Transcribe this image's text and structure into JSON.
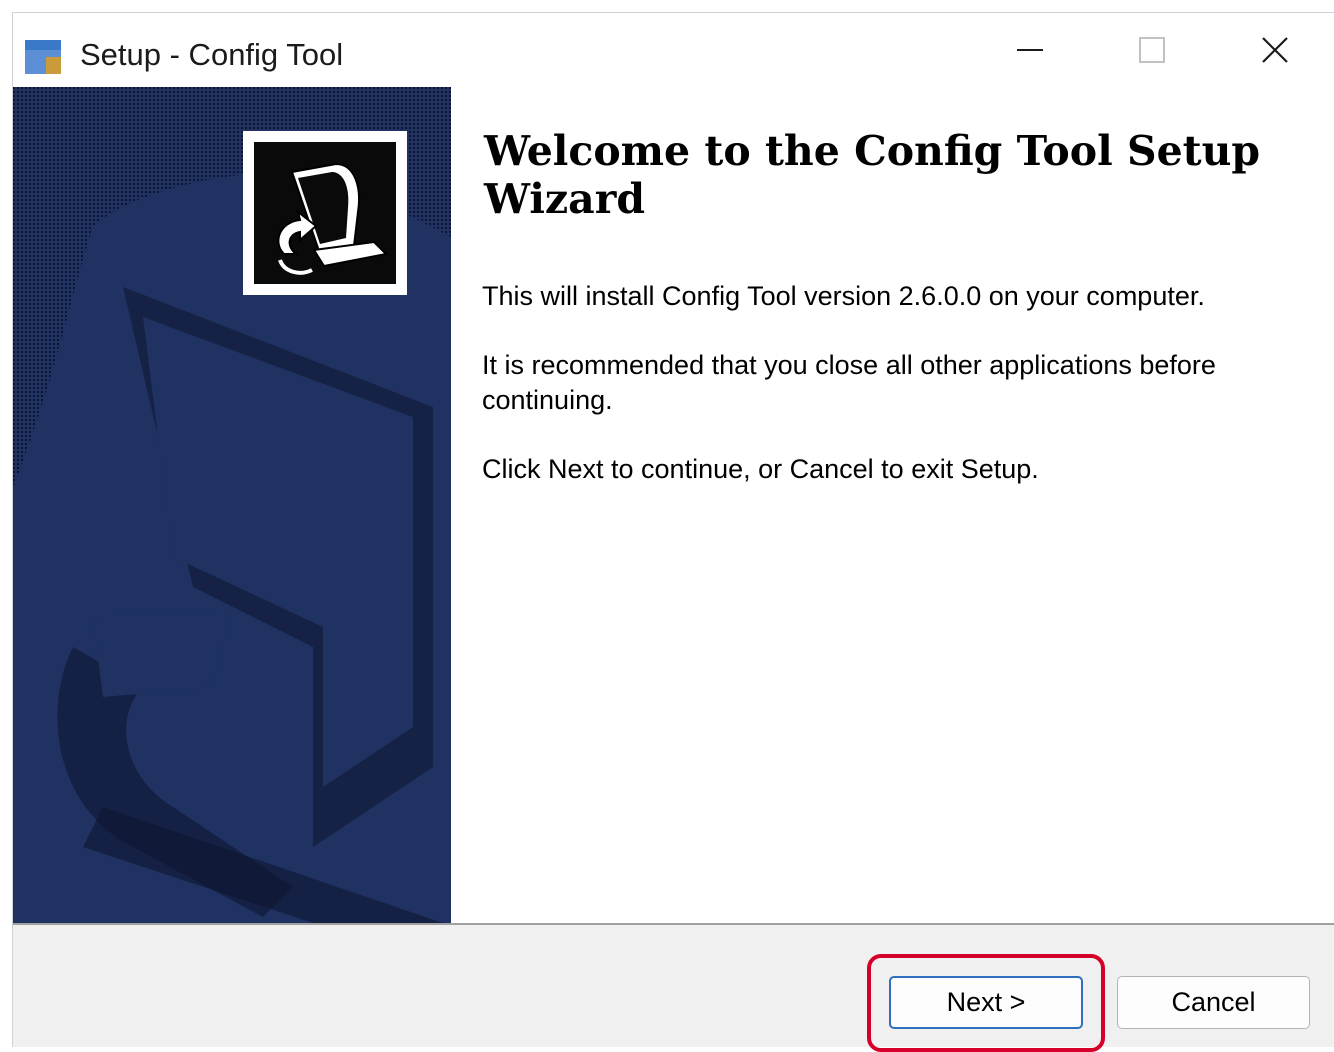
{
  "window": {
    "title": "Setup - Config Tool",
    "icon": "installer-box-icon",
    "controls": {
      "minimize": "minimize-icon",
      "maximize": "maximize-icon",
      "close": "close-icon"
    }
  },
  "side_panel": {
    "background_color": "#1f3261",
    "logo": "computer-install-icon"
  },
  "content": {
    "heading": "Welcome to the Config Tool Setup Wizard",
    "paragraphs": [
      "This will install Config Tool version 2.6.0.0 on your computer.",
      "It is recommended that you close all other applications before continuing.",
      "Click Next to continue, or Cancel to exit Setup."
    ]
  },
  "footer": {
    "next_label": "Next >",
    "cancel_label": "Cancel",
    "highlight_color": "#d4002a"
  }
}
